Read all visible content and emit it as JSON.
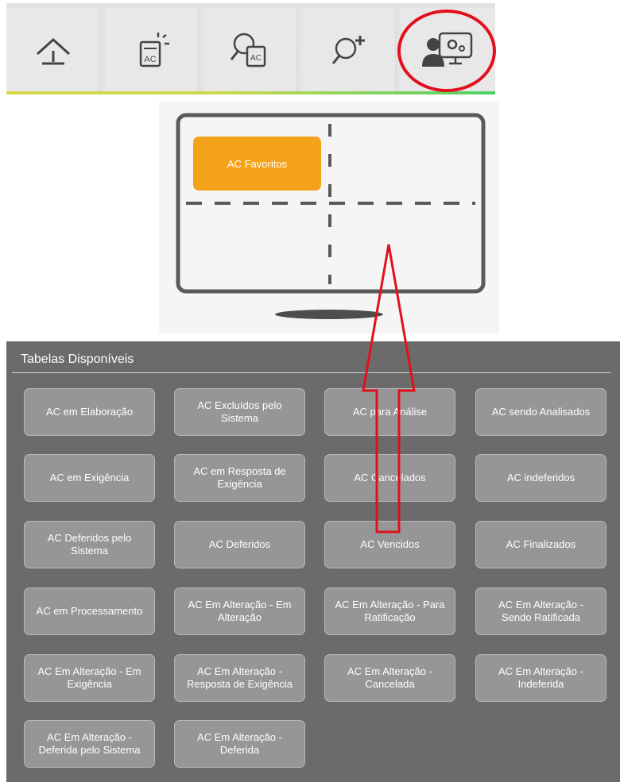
{
  "toolbar": {
    "icons": [
      "home-icon",
      "new-ac-icon",
      "search-ac-icon",
      "add-search-icon",
      "user-settings-icon"
    ]
  },
  "preview": {
    "favorite_label": "AC Favoritos"
  },
  "tables": {
    "title": "Tabelas Disponíveis",
    "items": [
      "AC em Elaboração",
      "AC Excluídos pelo Sistema",
      "AC para Análise",
      "AC sendo Analisados",
      "AC em Exigência",
      "AC em Resposta de Exigência",
      "AC Cancelados",
      "AC indeferidos",
      "AC Deferidos pelo Sistema",
      "AC Deferidos",
      "AC Vencidos",
      "AC Finalizados",
      "AC em Processamento",
      "AC Em Alteração - Em Alteração",
      "AC Em Alteração - Para Ratificação",
      "AC Em Alteração - Sendo Ratificada",
      "AC Em Alteração - Em Exigência",
      "AC Em Alteração - Resposta de Exigência",
      "AC Em Alteração - Cancelada",
      "AC Em Alteração - Indeferida",
      "AC Em Alteração - Deferida pelo Sistema",
      "AC Em Alteração - Deferida"
    ]
  },
  "colors": {
    "favorite": "#f5a21b",
    "panel": "#6b6b6b",
    "button": "#969696",
    "highlight": "#e2101d"
  }
}
